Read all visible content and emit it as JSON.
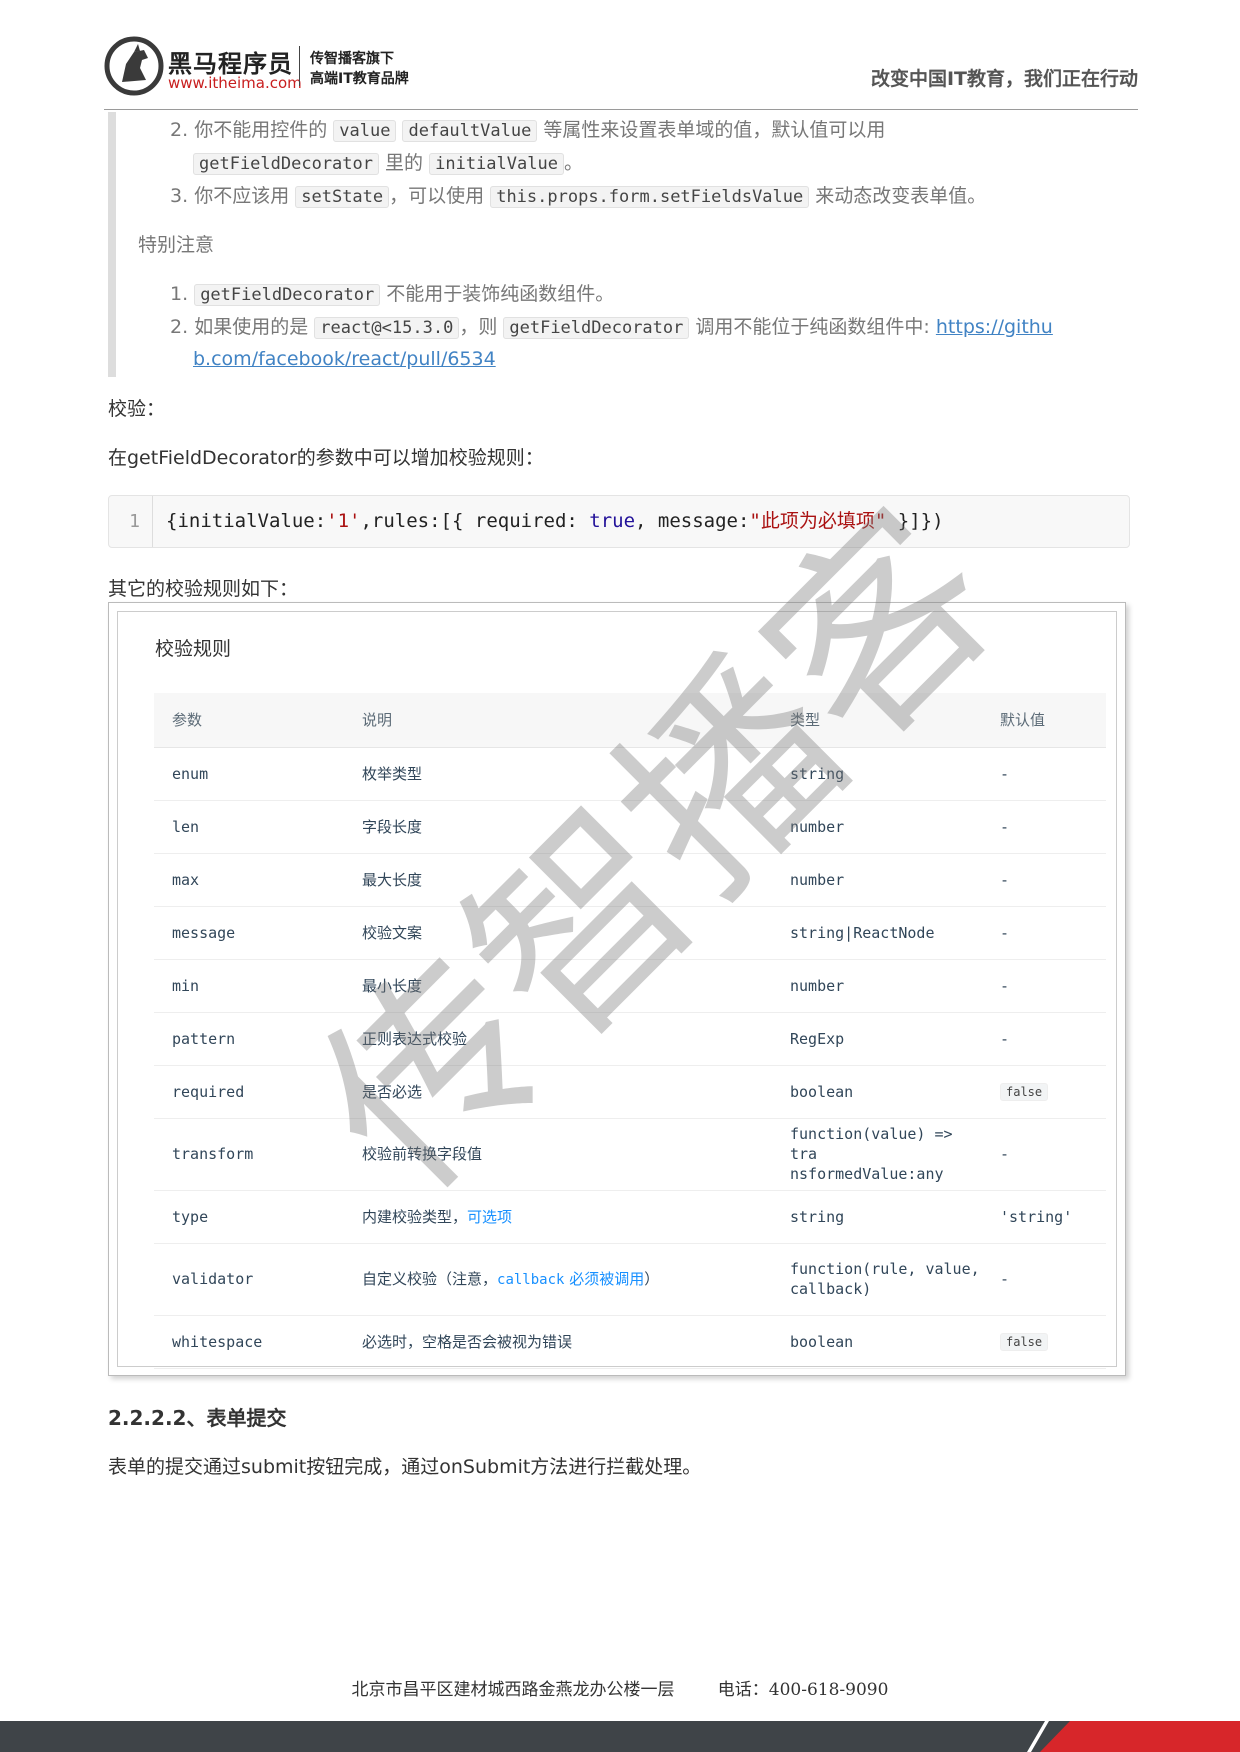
{
  "header": {
    "brand_name": "黑马程序员",
    "brand_url": "www.itheima.com",
    "brand_sub1": "传智播客旗下",
    "brand_sub2": "高端IT教育品牌",
    "slogan": "改变中国IT教育，我们正在行动"
  },
  "quote": {
    "list1": [
      {
        "num": "2.",
        "pre": "你不能用控件的",
        "code1": "value",
        "code2": "defaultValue",
        "post": "等属性来设置表单域的值，默认值可以用"
      },
      {
        "num": "3.",
        "pre": "你不应该用",
        "code1": "setState",
        "mid": "，可以使用",
        "code2": "this.props.form.setFieldsValue",
        "post": "来动态改变表单值。"
      }
    ],
    "list1_cont": {
      "code1": "getFieldDecorator",
      "mid": "里的",
      "code2": "initialValue",
      "post": "。"
    },
    "note_title": "特别注意",
    "list2": [
      {
        "num": "1.",
        "code1": "getFieldDecorator",
        "post": "不能用于装饰纯函数组件。"
      },
      {
        "num": "2.",
        "pre": "如果使用的是",
        "code1": "react@<15.3.0",
        "mid": "，则",
        "code2": "getFieldDecorator",
        "post": "调用不能位于纯函数组件中:",
        "link1": "https://githu",
        "link2": "b.com/facebook/react/pull/6534"
      }
    ]
  },
  "para_validate": "校验：",
  "para_rules_intro": "在getFieldDecorator的参数中可以增加校验规则：",
  "code_block": {
    "line_no": "1",
    "p1": "{initialValue:",
    "s1": "'1'",
    "p2": ",rules:[{ required: ",
    "kw": "true",
    "p3": ", message:",
    "s2": "\"此项为必填项\"",
    "p4": " }]})"
  },
  "para_other_rules": "其它的校验规则如下：",
  "rules_table": {
    "title": "校验规则",
    "headers": [
      "参数",
      "说明",
      "类型",
      "默认值"
    ],
    "rows": [
      {
        "param": "enum",
        "desc": "枚举类型",
        "type": "string",
        "default": "-"
      },
      {
        "param": "len",
        "desc": "字段长度",
        "type": "number",
        "default": "-"
      },
      {
        "param": "max",
        "desc": "最大长度",
        "type": "number",
        "default": "-"
      },
      {
        "param": "message",
        "desc": "校验文案",
        "type": "string|ReactNode",
        "default": "-"
      },
      {
        "param": "min",
        "desc": "最小长度",
        "type": "number",
        "default": "-"
      },
      {
        "param": "pattern",
        "desc": "正则表达式校验",
        "type": "RegExp",
        "default": "-"
      },
      {
        "param": "required",
        "desc": "是否必选",
        "type": "boolean",
        "default": "false"
      },
      {
        "param": "transform",
        "desc": "校验前转换字段值",
        "type_l1": "function(value) => tra",
        "type_l2": "nsformedValue:any",
        "default": "-"
      },
      {
        "param": "type",
        "desc": "内建校验类型，",
        "desc_link": "可选项",
        "type": "string",
        "default": "'string'"
      },
      {
        "param": "validator",
        "desc": "自定义校验（注意，",
        "desc_code": "callback",
        "desc_link": " 必须被调用",
        "desc_end": "）",
        "type_l1": "function(rule, value,",
        "type_l2": "callback)",
        "default": "-"
      },
      {
        "param": "whitespace",
        "desc": "必选时，空格是否会被视为错误",
        "type": "boolean",
        "default": "false"
      }
    ]
  },
  "section_heading": "2.2.2.2、表单提交",
  "para_submit": "表单的提交通过submit按钮完成，通过onSubmit方法进行拦截处理。",
  "watermark": "传智播客",
  "footer": {
    "address": "北京市昌平区建材城西路金燕龙办公楼一层",
    "phone": "电话：400-618-9090"
  }
}
